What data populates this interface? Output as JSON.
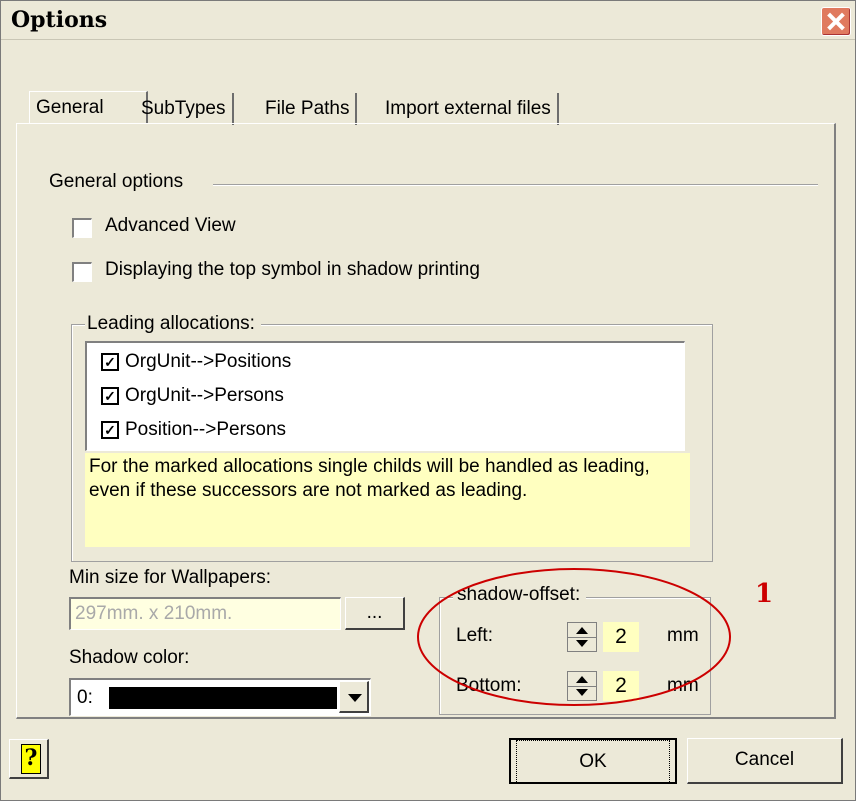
{
  "window": {
    "title": "Options"
  },
  "tabs": [
    {
      "label": "General"
    },
    {
      "label": "SubTypes"
    },
    {
      "label": "File Paths"
    },
    {
      "label": "Import external files"
    }
  ],
  "general": {
    "group_label": "General options",
    "advanced_view": {
      "label": "Advanced View",
      "checked": false
    },
    "top_symbol": {
      "label": "Displaying the top symbol in shadow printing",
      "checked": false
    }
  },
  "leading": {
    "group_label": "Leading allocations:",
    "items": [
      {
        "label": "OrgUnit-->Positions",
        "checked": true
      },
      {
        "label": "OrgUnit-->Persons",
        "checked": true
      },
      {
        "label": "Position-->Persons",
        "checked": true
      }
    ],
    "note": "For the marked allocations single childs will be handled as leading, even if these successors are not marked as leading."
  },
  "wallpaper": {
    "label": "Min size for Wallpapers:",
    "value": "297mm.  x  210mm.",
    "browse_label": "..."
  },
  "shadow_color": {
    "label": "Shadow color:",
    "value": "0:",
    "color": "#000000"
  },
  "shadow_offset": {
    "group_label": "shadow-offset:",
    "left_label": "Left:",
    "left_value": "2",
    "bottom_label": "Bottom:",
    "bottom_value": "2",
    "unit": "mm"
  },
  "annotation": {
    "label": "1",
    "color": "#cc0000"
  },
  "buttons": {
    "ok": "OK",
    "cancel": "Cancel"
  }
}
